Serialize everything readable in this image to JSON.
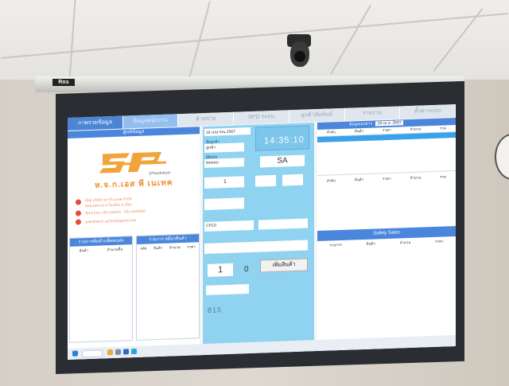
{
  "projector_brand": "Ros",
  "casing_label": "",
  "app": {
    "tabs": [
      "ภาพรวมข้อมูล",
      "ข้อมูลพนักงาน",
      "ฝ่ายขาย",
      "SPD ระบบ",
      "ลูกค้าสัมพันธ์",
      "รายงาน",
      "ตั้งค่าระบบ"
    ],
    "left_panel": {
      "header": "ศูนย์ข้อมูล",
      "logo_text": "SP",
      "logo_sub": "SPeedntech",
      "company": "ห.จ.ก.เอส พี เนเทค",
      "contact_lines": [
        "ที่อยู่ บริษัท เอส พี เนเทค จำกัด",
        "ซอยเทศบาล ต.ในเมือง อ.เมือง",
        "Tel & Fax: 055-254415 , 081-4428500",
        "speedntech.sp2020@gmail.com"
      ],
      "sub_left_header": "รายการสินค้าแพ็คขนส่ง",
      "sub_left_cols": [
        "สินค้า",
        "จำนวนชิ้น"
      ],
      "sub_right_header": "รายการ สต๊อกสินค้า",
      "sub_right_cols": [
        "รหัส",
        "สินค้า",
        "จำนวน",
        "ราคา"
      ]
    },
    "mid_panel": {
      "date_value": "18 เมษายน 2567",
      "time": "14:35:10",
      "field1_label": "ชื่อลูกค้า",
      "field1_value": "ลูกค้า",
      "field2_label": "ผู้ติดต่อ",
      "field2_value": "ทดสอบ",
      "badge": "SA",
      "qty_select": "1",
      "code_value": "CFC0",
      "qty": "1",
      "qty_zero": "0",
      "add_button": "เพิ่มสินค้า",
      "bottom_number": "815"
    },
    "right_panel": {
      "header_label": "ข้อมูลเอกสาร",
      "header_date": "18 เม.ย. 2567",
      "cols": [
        "ลำดับ",
        "สินค้า",
        "ราคา",
        "จำนวน",
        "รวม"
      ],
      "mid_cols": [
        "ลำดับ",
        "สินค้า",
        "ราคา",
        "จำนวน",
        "รวม"
      ],
      "safety_header": "Safety Sales",
      "safety_cols": [
        "รายการ",
        "สินค้า",
        "จำนวน",
        "ราคา"
      ]
    }
  },
  "colors": {
    "tab_blue": "#4d85d5",
    "middle_panel": "#8fd3f0",
    "logo_orange": "#ef8c2a"
  }
}
